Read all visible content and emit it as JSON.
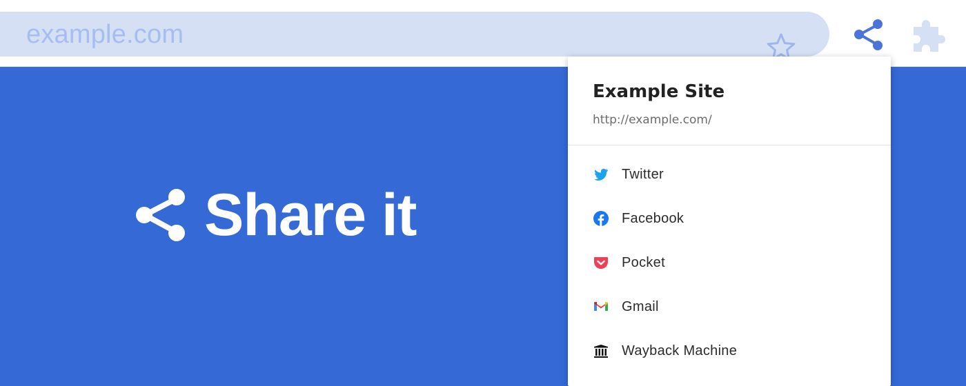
{
  "omnibox": {
    "url_text": "example.com"
  },
  "toolbar": {
    "star_icon": "star-icon",
    "share_icon": "share-icon",
    "extension_icon": "puzzle-icon"
  },
  "hero": {
    "title": "Share it",
    "icon": "share-icon"
  },
  "popup": {
    "site_title": "Example Site",
    "site_url": "http://example.com/",
    "items": [
      {
        "label": "Twitter",
        "icon": "twitter-icon",
        "color": "#1da1f2"
      },
      {
        "label": "Facebook",
        "icon": "facebook-icon",
        "color": "#1877f2"
      },
      {
        "label": "Pocket",
        "icon": "pocket-icon",
        "color": "#ef4056"
      },
      {
        "label": "Gmail",
        "icon": "gmail-icon",
        "color": "#ea4335"
      },
      {
        "label": "Wayback Machine",
        "icon": "archive-icon",
        "color": "#111111"
      }
    ]
  },
  "colors": {
    "page_background": "#3469d6",
    "omnibox_background": "#d5e0f5",
    "accent": "#4a74d9"
  }
}
